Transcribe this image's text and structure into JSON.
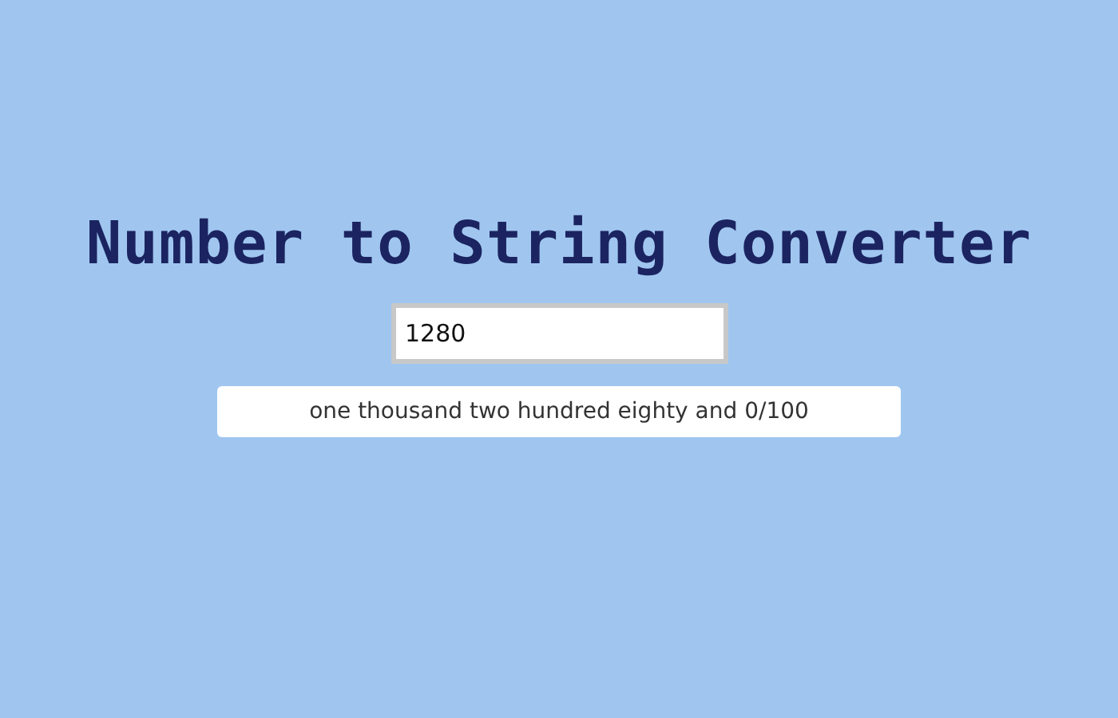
{
  "title": "Number to String Converter",
  "number_field": {
    "value": "1280"
  },
  "result": "one thousand two hundred eighty and 0/100"
}
